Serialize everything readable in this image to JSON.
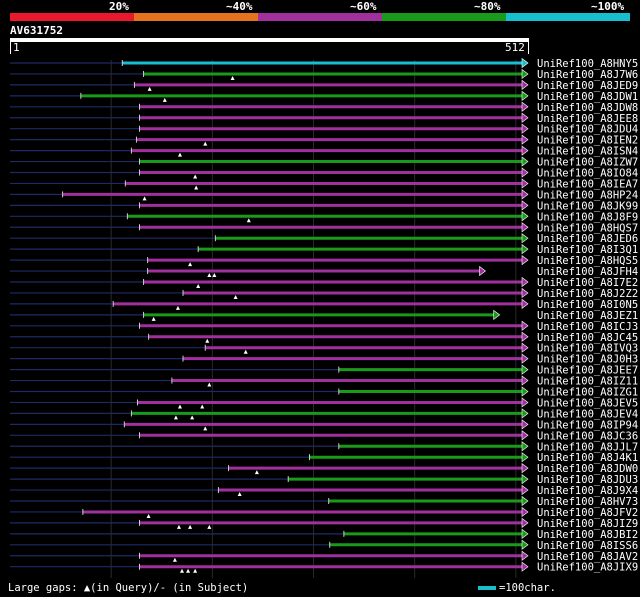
{
  "legend": {
    "segments": [
      {
        "label": "20%",
        "color": "#e8192c"
      },
      {
        "label": "~40%",
        "color": "#e6711e"
      },
      {
        "label": "~60%",
        "color": "#a0309e"
      },
      {
        "label": "~80%",
        "color": "#1a9a1a"
      },
      {
        "label": "~100%",
        "color": "#17becf"
      }
    ]
  },
  "query": {
    "id": "AV631752",
    "start_label": "1",
    "end_label": "512"
  },
  "hits": [
    {
      "name": "UniRef100_A8HNY5",
      "color": "#17becf",
      "start": 111,
      "tail_start": 0.0,
      "gaps": []
    },
    {
      "name": "UniRef100_A8J7W6",
      "color": "#1a9a1a",
      "start": 132,
      "tail_start": 0.0,
      "gaps": [
        220
      ]
    },
    {
      "name": "UniRef100_A8JED9",
      "color": "#a0309e",
      "start": 123,
      "tail_start": 0.0,
      "gaps": [
        138
      ]
    },
    {
      "name": "UniRef100_A8JDW1",
      "color": "#1a9a1a",
      "start": 70,
      "tail_start": 0.0,
      "gaps": [
        153
      ]
    },
    {
      "name": "UniRef100_A8JDW8",
      "color": "#a0309e",
      "start": 128,
      "tail_start": 0.0,
      "gaps": []
    },
    {
      "name": "UniRef100_A8JEE8",
      "color": "#a0309e",
      "start": 128,
      "tail_start": 0.0,
      "gaps": []
    },
    {
      "name": "UniRef100_A8JDU4",
      "color": "#a0309e",
      "start": 128,
      "tail_start": 0.0,
      "gaps": []
    },
    {
      "name": "UniRef100_A8IEN2",
      "color": "#a0309e",
      "start": 125,
      "tail_start": 0.0,
      "gaps": [
        193
      ]
    },
    {
      "name": "UniRef100_A8ISN4",
      "color": "#a0309e",
      "start": 120,
      "tail_start": 0.0,
      "gaps": [
        168
      ]
    },
    {
      "name": "UniRef100_A8IZW7",
      "color": "#1a9a1a",
      "start": 128,
      "tail_start": 0.0,
      "gaps": []
    },
    {
      "name": "UniRef100_A8IO84",
      "color": "#a0309e",
      "start": 128,
      "tail_start": 0.0,
      "gaps": [
        183
      ]
    },
    {
      "name": "UniRef100_A8IEA7",
      "color": "#a0309e",
      "start": 114,
      "tail_start": 0.0,
      "gaps": [
        184
      ]
    },
    {
      "name": "UniRef100_A8HP24",
      "color": "#a0309e",
      "start": 52,
      "tail_start": 0.0,
      "gaps": [
        133
      ]
    },
    {
      "name": "UniRef100_A8JK99",
      "color": "#a0309e",
      "start": 128,
      "tail_start": 0.0,
      "gaps": []
    },
    {
      "name": "UniRef100_A8J8F9",
      "color": "#1a9a1a",
      "start": 116,
      "tail_start": 0.0,
      "gaps": [
        236
      ]
    },
    {
      "name": "UniRef100_A8HQS7",
      "color": "#a0309e",
      "start": 128,
      "tail_start": 0.0,
      "gaps": []
    },
    {
      "name": "UniRef100_A8JED6",
      "color": "#1a9a1a",
      "start": 203,
      "tail_start": 0.0,
      "gaps": []
    },
    {
      "name": "UniRef100_A8I3Q1",
      "color": "#1a9a1a",
      "start": 186,
      "tail_start": 0.0,
      "gaps": []
    },
    {
      "name": "UniRef100_A8HQS5",
      "color": "#a0309e",
      "start": 136,
      "tail_start": 0.0,
      "gaps": [
        178
      ]
    },
    {
      "name": "UniRef100_A8JFH4",
      "color": "#a0309e",
      "start": 136,
      "tail_start": 0.0,
      "gaps": [
        197,
        202
      ],
      "end": 470
    },
    {
      "name": "UniRef100_A8I7E2",
      "color": "#a0309e",
      "start": 132,
      "tail_start": 0.0,
      "gaps": [
        186
      ]
    },
    {
      "name": "UniRef100_A8J2Z2",
      "color": "#a0309e",
      "start": 171,
      "tail_start": 0.0,
      "gaps": [
        223
      ]
    },
    {
      "name": "UniRef100_A8I0N5",
      "color": "#a0309e",
      "start": 102,
      "tail_start": 0.0,
      "gaps": [
        166
      ]
    },
    {
      "name": "UniRef100_A8JEZ1",
      "color": "#1a9a1a",
      "start": 132,
      "tail_start": 0.0,
      "gaps": [
        142
      ],
      "end": 484
    },
    {
      "name": "UniRef100_A8ICJ3",
      "color": "#a0309e",
      "start": 128,
      "tail_start": 0.0,
      "gaps": []
    },
    {
      "name": "UniRef100_A8JC45",
      "color": "#a0309e",
      "start": 137,
      "tail_start": 0.0,
      "gaps": [
        195
      ]
    },
    {
      "name": "UniRef100_A8IVQ3",
      "color": "#a0309e",
      "start": 193,
      "tail_start": 0.0,
      "gaps": [
        233
      ]
    },
    {
      "name": "UniRef100_A8J0H3",
      "color": "#a0309e",
      "start": 171,
      "tail_start": 0.0,
      "gaps": []
    },
    {
      "name": "UniRef100_A8JEE7",
      "color": "#1a9a1a",
      "start": 325,
      "tail_start": 0.0,
      "gaps": []
    },
    {
      "name": "UniRef100_A8IZ11",
      "color": "#a0309e",
      "start": 160,
      "tail_start": 0.0,
      "gaps": [
        197
      ]
    },
    {
      "name": "UniRef100_A8IZG1",
      "color": "#1a9a1a",
      "start": 325,
      "tail_start": 0.0,
      "gaps": []
    },
    {
      "name": "UniRef100_A8JEV5",
      "color": "#a0309e",
      "start": 126,
      "tail_start": 0.0,
      "gaps": [
        168,
        190
      ]
    },
    {
      "name": "UniRef100_A8JEV4",
      "color": "#1a9a1a",
      "start": 120,
      "tail_start": 0.0,
      "gaps": [
        164,
        180
      ]
    },
    {
      "name": "UniRef100_A8IP94",
      "color": "#a0309e",
      "start": 113,
      "tail_start": 0.0,
      "gaps": [
        193
      ]
    },
    {
      "name": "UniRef100_A8JC36",
      "color": "#a0309e",
      "start": 128,
      "tail_start": 0.0,
      "gaps": []
    },
    {
      "name": "UniRef100_A8JJL7",
      "color": "#1a9a1a",
      "start": 325,
      "tail_start": 0.0,
      "gaps": []
    },
    {
      "name": "UniRef100_A8J4K1",
      "color": "#1a9a1a",
      "start": 296,
      "tail_start": 0.0,
      "gaps": []
    },
    {
      "name": "UniRef100_A8JDW0",
      "color": "#a0309e",
      "start": 216,
      "tail_start": 0.0,
      "gaps": [
        244
      ]
    },
    {
      "name": "UniRef100_A8JDU3",
      "color": "#1a9a1a",
      "start": 275,
      "tail_start": 0.0,
      "gaps": []
    },
    {
      "name": "UniRef100_A8J9X4",
      "color": "#a0309e",
      "start": 206,
      "tail_start": 0.0,
      "gaps": [
        227
      ]
    },
    {
      "name": "UniRef100_A8HV73",
      "color": "#1a9a1a",
      "start": 315,
      "tail_start": 0.0,
      "gaps": []
    },
    {
      "name": "UniRef100_A8JFV2",
      "color": "#a0309e",
      "start": 72,
      "tail_start": 0.0,
      "gaps": [
        137
      ]
    },
    {
      "name": "UniRef100_A8JIZ9",
      "color": "#a0309e",
      "start": 128,
      "tail_start": 0.0,
      "gaps": [
        167,
        178,
        197
      ]
    },
    {
      "name": "UniRef100_A8JBI2",
      "color": "#1a9a1a",
      "start": 330,
      "tail_start": 0.0,
      "gaps": []
    },
    {
      "name": "UniRef100_A8ISS6",
      "color": "#1a9a1a",
      "start": 316,
      "tail_start": 0.0,
      "gaps": []
    },
    {
      "name": "UniRef100_A8JAV2",
      "color": "#a0309e",
      "start": 128,
      "tail_start": 0.0,
      "gaps": [
        163
      ]
    },
    {
      "name": "UniRef100_A8JIX9",
      "color": "#a0309e",
      "start": 128,
      "tail_start": 0.0,
      "gaps": [
        170,
        176,
        183
      ]
    }
  ],
  "footer": {
    "left": "Large gaps: ▲(in Query)/- (in Subject)",
    "right": "=100char."
  }
}
